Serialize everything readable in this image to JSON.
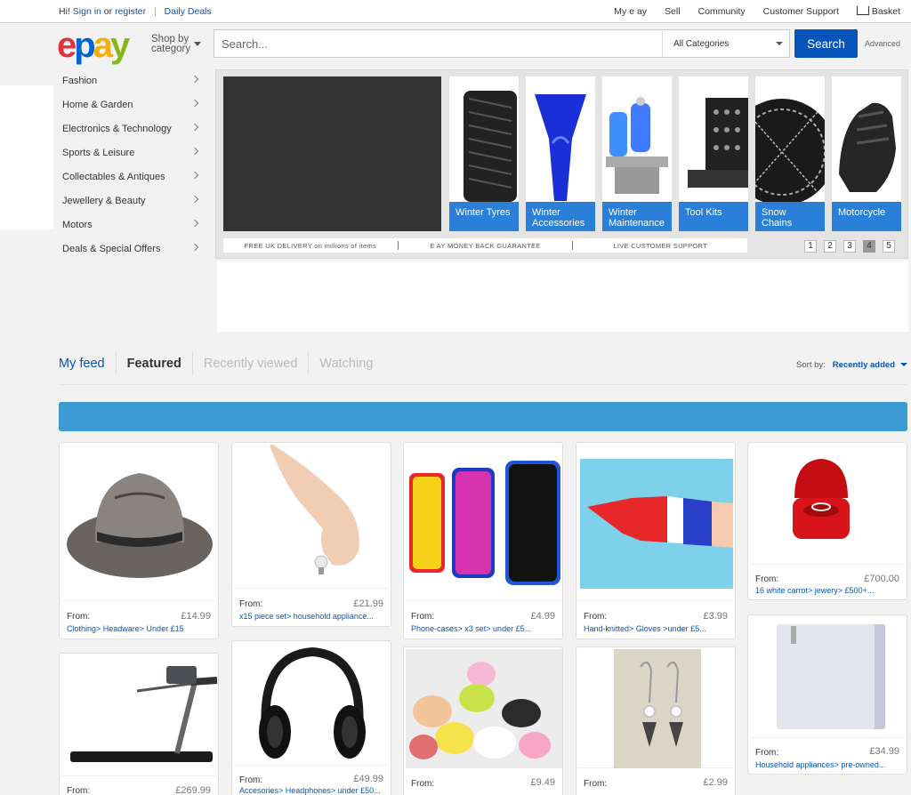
{
  "topbar": {
    "greeting": "Hi!",
    "sign_in": "Sign in",
    "or": "or",
    "register": "register",
    "daily_deals": "Daily Deals",
    "my_ebay": "My e  ay",
    "sell": "Sell",
    "community": "Community",
    "support": "Customer Support",
    "basket": "Basket"
  },
  "header": {
    "logo": [
      "e",
      "p",
      "a",
      "y"
    ],
    "shop_by_1": "Shop by",
    "shop_by_2": "category",
    "search_placeholder": "Search...",
    "category_select": "All Categories",
    "search_button": "Search",
    "advanced": "Advanced"
  },
  "sidebar": {
    "items": [
      {
        "label": "Fashion"
      },
      {
        "label": "Home & Garden"
      },
      {
        "label": "Electronics & Technology"
      },
      {
        "label": "Sports & Leisure"
      },
      {
        "label": "Collectables & Antiques"
      },
      {
        "label": "Jewellery & Beauty"
      },
      {
        "label": "Motors"
      },
      {
        "label": "Deals & Special Offers"
      }
    ]
  },
  "hero": {
    "tiles": [
      {
        "label1": "Winter Tyres",
        "label2": ""
      },
      {
        "label1": "Winter",
        "label2": "Accessories"
      },
      {
        "label1": "Winter",
        "label2": "Maintenance"
      },
      {
        "label1": "Tool Kits",
        "label2": ""
      },
      {
        "label1": "Snow",
        "label2": "Chains"
      },
      {
        "label1": "Motorcycle",
        "label2": ""
      }
    ],
    "benefits": [
      "FREE UK DELIVERY on millions of items",
      "E  AY MONEY BACK GUARANTEE",
      "LIVE CUSTOMER SUPPORT"
    ],
    "pages": [
      "1",
      "2",
      "3",
      "4",
      "5"
    ],
    "active_page": "4"
  },
  "feed": {
    "tabs": [
      "My feed",
      "Featured",
      "Recently viewed",
      "Watching"
    ],
    "sort_label": "Sort by:",
    "sort_value": "Recently added"
  },
  "items": [
    {
      "from": "From:",
      "price": "£14.99",
      "crumb": "Clothing> Headware> Under £15"
    },
    {
      "from": "From:",
      "price": "£21.99",
      "crumb": "x15 piece set> household appliance..."
    },
    {
      "from": "From:",
      "price": "£4.99",
      "crumb": "Phone-cases> x3 set> under £5..."
    },
    {
      "from": "From:",
      "price": "£3.99",
      "crumb": "Hand-knitted> Gloves >under £5..."
    },
    {
      "from": "From:",
      "price": "£700.00",
      "crumb": "16 white carrot> jewery> £500+..."
    },
    {
      "from": "From:",
      "price": "£269.99",
      "crumb": ""
    },
    {
      "from": "From:",
      "price": "£49.99",
      "crumb": "Accesories> Headphones> under £50..."
    },
    {
      "from": "From:",
      "price": "£9.49",
      "crumb": ""
    },
    {
      "from": "From:",
      "price": "£2.99",
      "crumb": ""
    },
    {
      "from": "From:",
      "price": "£34.99",
      "crumb": "Household appliances> pre-owned..."
    }
  ]
}
